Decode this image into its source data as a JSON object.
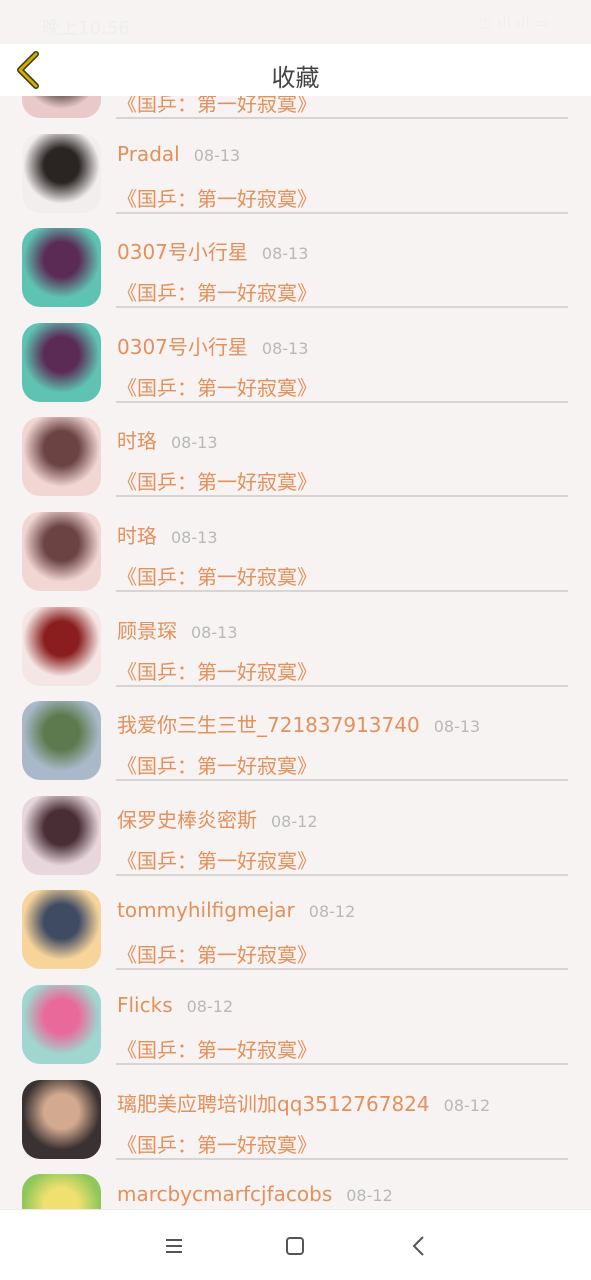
{
  "status_bar": {
    "time": "晚上10:56",
    "indicators": "◫ ıll ıll ▭"
  },
  "header": {
    "title": "收藏",
    "back_icon": "chevron-left-icon"
  },
  "favorites": [
    {
      "name": "",
      "date": "",
      "work": "《国乒：第一好寂寞》",
      "avatar_colors": [
        "#e9c9c9",
        "#3a2a2a"
      ]
    },
    {
      "name": "Pradal",
      "date": "08-13",
      "work": "《国乒：第一好寂寞》",
      "avatar_colors": [
        "#f2eeee",
        "#2a2422"
      ]
    },
    {
      "name": "0307号小行星",
      "date": "08-13",
      "work": "《国乒：第一好寂寞》",
      "avatar_colors": [
        "#5fc3b3",
        "#5b2a55"
      ]
    },
    {
      "name": "0307号小行星",
      "date": "08-13",
      "work": "《国乒：第一好寂寞》",
      "avatar_colors": [
        "#5fc3b3",
        "#5b2a55"
      ]
    },
    {
      "name": "时珞",
      "date": "08-13",
      "work": "《国乒：第一好寂寞》",
      "avatar_colors": [
        "#f1d6d4",
        "#6b4343"
      ]
    },
    {
      "name": "时珞",
      "date": "08-13",
      "work": "《国乒：第一好寂寞》",
      "avatar_colors": [
        "#f1d6d4",
        "#6b4343"
      ]
    },
    {
      "name": "顾景琛",
      "date": "08-13",
      "work": "《国乒：第一好寂寞》",
      "avatar_colors": [
        "#f4e6e4",
        "#8a1e1e"
      ]
    },
    {
      "name": "我爱你三生三世_721837913740",
      "date": "08-13",
      "work": "《国乒：第一好寂寞》",
      "avatar_colors": [
        "#a9b9c9",
        "#5c7a4d"
      ]
    },
    {
      "name": "保罗史棒炎密斯",
      "date": "08-12",
      "work": "《国乒：第一好寂寞》",
      "avatar_colors": [
        "#e7d6dc",
        "#4a2e36"
      ]
    },
    {
      "name": "tommyhilfigmejar",
      "date": "08-12",
      "work": "《国乒：第一好寂寞》",
      "avatar_colors": [
        "#f6d49a",
        "#3f4a63"
      ]
    },
    {
      "name": "Flicks",
      "date": "08-12",
      "work": "《国乒：第一好寂寞》",
      "avatar_colors": [
        "#9fd7cf",
        "#e96a9a"
      ]
    },
    {
      "name": "璃肥美应聘培训加qq3512767824",
      "date": "08-12",
      "work": "《国乒：第一好寂寞》",
      "avatar_colors": [
        "#3a3232",
        "#d3aa8f"
      ]
    },
    {
      "name": "marcbycmarfcjfacobs",
      "date": "08-12",
      "work": "",
      "avatar_colors": [
        "#8fc75a",
        "#f0e070"
      ]
    }
  ],
  "nav_bar": {
    "menu_icon": "menu-icon",
    "home_icon": "home-square-icon",
    "back_icon": "back-chevron-icon"
  },
  "colors": {
    "accent": "#e3905b",
    "date": "#b8b8b8",
    "background": "#f7f3f3",
    "back_arrow": "#c9a400"
  }
}
